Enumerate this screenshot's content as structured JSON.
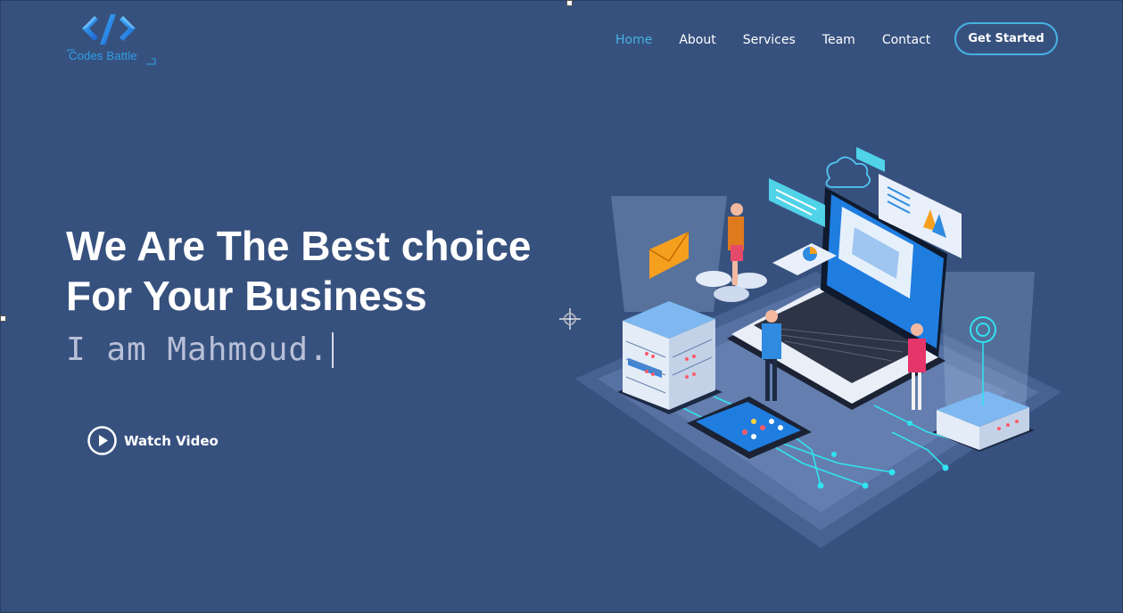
{
  "brand": {
    "logo_text": "Codes Battle",
    "icon": "code-brackets-icon"
  },
  "nav": {
    "items": [
      {
        "label": "Home",
        "active": true
      },
      {
        "label": "About",
        "active": false
      },
      {
        "label": "Services",
        "active": false
      },
      {
        "label": "Team",
        "active": false
      },
      {
        "label": "Contact",
        "active": false
      }
    ],
    "cta_label": "Get Started"
  },
  "hero": {
    "title_line1": "We Are The Best choice",
    "title_line2": "For Your Business",
    "typed_text": "I am Mahmoud.",
    "watch_video_label": "Watch Video",
    "illustration": "isometric-tech-illustration"
  },
  "colors": {
    "background": "#37517e",
    "accent": "#47b2e4",
    "text": "#ffffff",
    "typed_text": "#b8c0d8"
  }
}
